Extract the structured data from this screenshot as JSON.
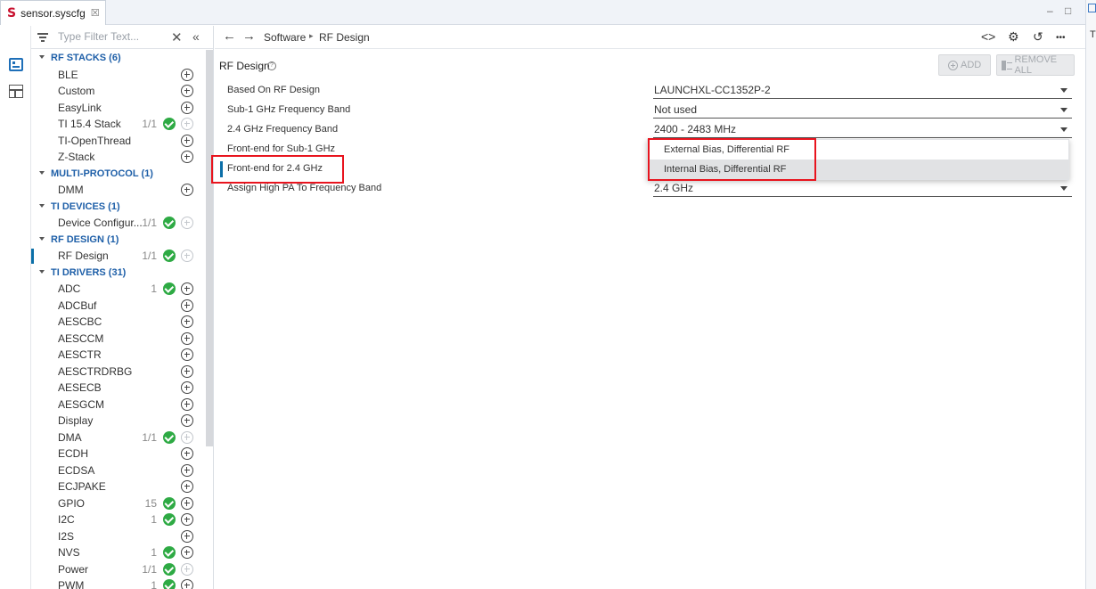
{
  "editor_tab": {
    "title": "sensor.syscfg",
    "logo_glyph": "S",
    "close_glyph": "☒"
  },
  "window_controls": {
    "minimize": "–",
    "maximize": "□"
  },
  "far_panel": {
    "text": "T"
  },
  "filter": {
    "placeholder": "Type Filter Text...",
    "clear_glyph": "✕",
    "collapse_glyph": "«"
  },
  "tree": {
    "categories": [
      {
        "label": "RF STACKS (6)",
        "modules": [
          {
            "label": "BLE",
            "count": "",
            "added": false,
            "add_enabled": true
          },
          {
            "label": "Custom",
            "count": "",
            "added": false,
            "add_enabled": true
          },
          {
            "label": "EasyLink",
            "count": "",
            "added": false,
            "add_enabled": true
          },
          {
            "label": "TI 15.4 Stack",
            "count": "1/1",
            "added": true,
            "add_enabled": false
          },
          {
            "label": "TI-OpenThread",
            "count": "",
            "added": false,
            "add_enabled": true
          },
          {
            "label": "Z-Stack",
            "count": "",
            "added": false,
            "add_enabled": true
          }
        ]
      },
      {
        "label": "MULTI-PROTOCOL (1)",
        "modules": [
          {
            "label": "DMM",
            "count": "",
            "added": false,
            "add_enabled": true
          }
        ]
      },
      {
        "label": "TI DEVICES (1)",
        "modules": [
          {
            "label": "Device Configur...",
            "count": "1/1",
            "added": true,
            "add_enabled": false
          }
        ]
      },
      {
        "label": "RF DESIGN (1)",
        "modules": [
          {
            "label": "RF Design",
            "count": "1/1",
            "added": true,
            "add_enabled": false,
            "active": true
          }
        ]
      },
      {
        "label": "TI DRIVERS (31)",
        "modules": [
          {
            "label": "ADC",
            "count": "1",
            "added": true,
            "add_enabled": true
          },
          {
            "label": "ADCBuf",
            "count": "",
            "added": false,
            "add_enabled": true
          },
          {
            "label": "AESCBC",
            "count": "",
            "added": false,
            "add_enabled": true
          },
          {
            "label": "AESCCM",
            "count": "",
            "added": false,
            "add_enabled": true
          },
          {
            "label": "AESCTR",
            "count": "",
            "added": false,
            "add_enabled": true
          },
          {
            "label": "AESCTRDRBG",
            "count": "",
            "added": false,
            "add_enabled": true
          },
          {
            "label": "AESECB",
            "count": "",
            "added": false,
            "add_enabled": true
          },
          {
            "label": "AESGCM",
            "count": "",
            "added": false,
            "add_enabled": true
          },
          {
            "label": "Display",
            "count": "",
            "added": false,
            "add_enabled": true
          },
          {
            "label": "DMA",
            "count": "1/1",
            "added": true,
            "add_enabled": false
          },
          {
            "label": "ECDH",
            "count": "",
            "added": false,
            "add_enabled": true
          },
          {
            "label": "ECDSA",
            "count": "",
            "added": false,
            "add_enabled": true
          },
          {
            "label": "ECJPAKE",
            "count": "",
            "added": false,
            "add_enabled": true
          },
          {
            "label": "GPIO",
            "count": "15",
            "added": true,
            "add_enabled": true
          },
          {
            "label": "I2C",
            "count": "1",
            "added": true,
            "add_enabled": true
          },
          {
            "label": "I2S",
            "count": "",
            "added": false,
            "add_enabled": true
          },
          {
            "label": "NVS",
            "count": "1",
            "added": true,
            "add_enabled": true
          },
          {
            "label": "Power",
            "count": "1/1",
            "added": true,
            "add_enabled": false
          },
          {
            "label": "PWM",
            "count": "1",
            "added": true,
            "add_enabled": true
          }
        ]
      }
    ]
  },
  "breadcrumb": {
    "back": "←",
    "forward": "→",
    "items": [
      "Software",
      "RF Design"
    ],
    "separator": "▸"
  },
  "top_icons": {
    "code": "<>",
    "chip": "⚙",
    "history": "↺",
    "more": "•••"
  },
  "section": {
    "title": "RF Design",
    "help": "?"
  },
  "buttons": {
    "add": "ADD",
    "remove_all": "REMOVE ALL"
  },
  "config": [
    {
      "label": "Based On RF Design",
      "value": "LAUNCHXL-CC1352P-2"
    },
    {
      "label": "Sub-1 GHz Frequency Band",
      "value": "Not used"
    },
    {
      "label": "2.4 GHz Frequency Band",
      "value": "2400 - 2483 MHz"
    },
    {
      "label": "Front-end for Sub-1 GHz",
      "value": ""
    },
    {
      "label": "Front-end for 2.4 GHz",
      "value": ""
    },
    {
      "label": "Assign High PA To Frequency Band",
      "value": "2.4 GHz"
    }
  ],
  "dropdown": {
    "options": [
      "External Bias, Differential RF",
      "Internal Bias, Differential RF"
    ],
    "highlighted_index": 1
  },
  "colors": {
    "accent": "#1e5fa8",
    "added_check": "#2eaa44",
    "annotation": "#e8141e",
    "active_marker": "#0b6fa8"
  }
}
